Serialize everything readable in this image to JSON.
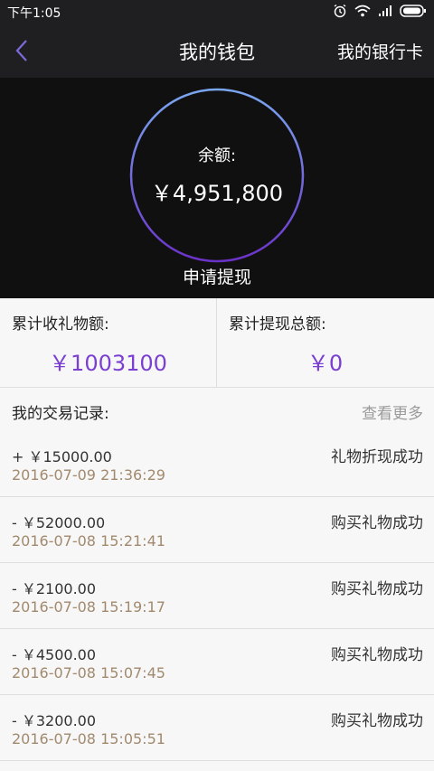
{
  "status_bar": {
    "time": "下午1:05"
  },
  "nav": {
    "title": "我的钱包",
    "right_label": "我的银行卡"
  },
  "balance": {
    "label": "余额:",
    "amount": "￥4,951,800",
    "withdraw_label": "申请提现"
  },
  "stats": {
    "gifts_label": "累计收礼物额:",
    "gifts_value": "￥1003100",
    "withdraw_label": "累计提现总额:",
    "withdraw_value": "￥0"
  },
  "records": {
    "title": "我的交易记录:",
    "more": "查看更多",
    "items": [
      {
        "amount": "+ ￥15000.00",
        "date": "2016-07-09 21:36:29",
        "status": "礼物折现成功"
      },
      {
        "amount": "- ￥52000.00",
        "date": "2016-07-08 15:21:41",
        "status": "购买礼物成功"
      },
      {
        "amount": "- ￥2100.00",
        "date": "2016-07-08 15:19:17",
        "status": "购买礼物成功"
      },
      {
        "amount": "- ￥4500.00",
        "date": "2016-07-08 15:07:45",
        "status": "购买礼物成功"
      },
      {
        "amount": "- ￥3200.00",
        "date": "2016-07-08 15:05:51",
        "status": "购买礼物成功"
      }
    ]
  },
  "colors": {
    "accent": "#7b3fd1",
    "ring_start": "#7aa7f0",
    "ring_end": "#6b32c8",
    "dark_bg": "#1f1f21",
    "date": "#a28a6e"
  },
  "icons": [
    "alarm-icon",
    "wifi-icon",
    "signal-icon",
    "battery-icon",
    "back-arrow-icon"
  ]
}
